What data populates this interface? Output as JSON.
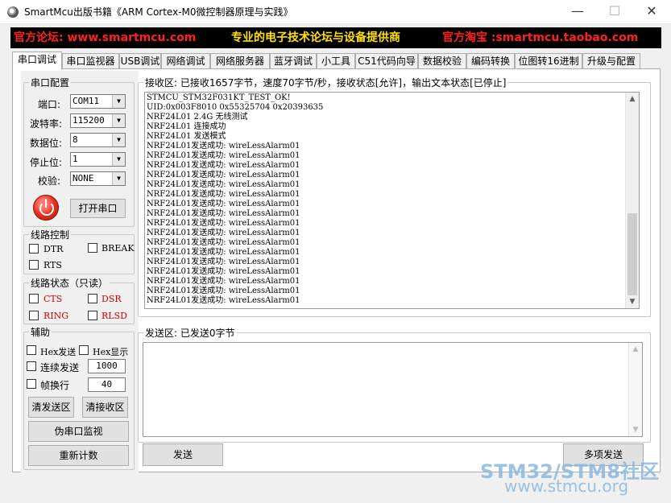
{
  "window": {
    "title": "SmartMcu出版书籍《ARM Cortex-M0微控制器原理与实践》",
    "min_glyph": "—",
    "max_glyph": "☐",
    "close_glyph": "✕"
  },
  "banner": {
    "left": "官方论坛: www.smartmcu.com",
    "middle": "专业的电子技术论坛与设备提供商",
    "right": "官方淘宝 :smartmcu.taobao.com"
  },
  "tabs": [
    {
      "label": "串口调试",
      "active": true
    },
    {
      "label": "串口监视器"
    },
    {
      "label": "USB调试"
    },
    {
      "label": "网络调试"
    },
    {
      "label": "网络服务器"
    },
    {
      "label": "蓝牙调试"
    },
    {
      "label": "小工具"
    },
    {
      "label": "C51代码向导"
    },
    {
      "label": "数据校验"
    },
    {
      "label": "编码转换"
    },
    {
      "label": "位图转16进制"
    },
    {
      "label": "升级与配置"
    }
  ],
  "serial_config": {
    "legend": "串口配置",
    "port_label": "端口:",
    "port_value": "COM11",
    "baud_label": "波特率:",
    "baud_value": "115200",
    "databits_label": "数据位:",
    "databits_value": "8",
    "stopbits_label": "停止位:",
    "stopbits_value": "1",
    "parity_label": "校验:",
    "parity_value": "NONE",
    "open_button": "打开串口"
  },
  "line_control": {
    "legend": "线路控制",
    "dtr": "DTR",
    "break": "BREAK",
    "rts": "RTS"
  },
  "line_status": {
    "legend": "线路状态（只读）",
    "cts": "CTS",
    "dsr": "DSR",
    "ring": "RING",
    "rlsd": "RLSD"
  },
  "aux": {
    "legend": "辅助",
    "hex_send": "Hex发送",
    "hex_display": "Hex显示",
    "continuous_send": "连续发送",
    "interval_value": "1000",
    "frame_newline": "帧换行",
    "frame_value": "40",
    "clear_send": "清发送区",
    "clear_recv": "清接收区",
    "fake_monitor": "伪串口监视",
    "reset_count": "重新计数"
  },
  "receive": {
    "legend": "接收区: 已接收1657字节，速度70字节/秒，接收状态[允许]，输出文本状态[已停止]",
    "lines": [
      "STMCU_STM32F031KT_TEST_OK!",
      "UID:0x003F8010 0x55325704 0x20393635",
      "NRF24L01 2.4G 无线测试",
      "NRF24L01 连接成功",
      "NRF24L01 发送模式",
      "NRF24L01发送成功: wireLessAlarm01",
      "NRF24L01发送成功: wireLessAlarm01",
      "NRF24L01发送成功: wireLessAlarm01",
      "NRF24L01发送成功: wireLessAlarm01",
      "NRF24L01发送成功: wireLessAlarm01",
      "NRF24L01发送成功: wireLessAlarm01",
      "NRF24L01发送成功: wireLessAlarm01",
      "NRF24L01发送成功: wireLessAlarm01",
      "NRF24L01发送成功: wireLessAlarm01",
      "NRF24L01发送成功: wireLessAlarm01",
      "NRF24L01发送成功: wireLessAlarm01",
      "NRF24L01发送成功: wireLessAlarm01",
      "NRF24L01发送成功: wireLessAlarm01",
      "NRF24L01发送成功: wireLessAlarm01",
      "NRF24L01发送成功: wireLessAlarm01",
      "NRF24L01发送成功: wireLessAlarm01",
      "NRF24L01发送成功: wireLessAlarm01"
    ]
  },
  "send": {
    "legend": "发送区: 已发送0字节",
    "send_button": "发送",
    "multi_send_button": "多项发送"
  },
  "watermark": {
    "top": "STM32/STM8社区",
    "bottom": "www.stmcu.org"
  },
  "colors": {
    "banner_bg": "#000000",
    "banner_red": "#ff2020",
    "banner_yellow": "#ffe000",
    "status_red": "#d00000",
    "watermark": "#8ab8df"
  }
}
